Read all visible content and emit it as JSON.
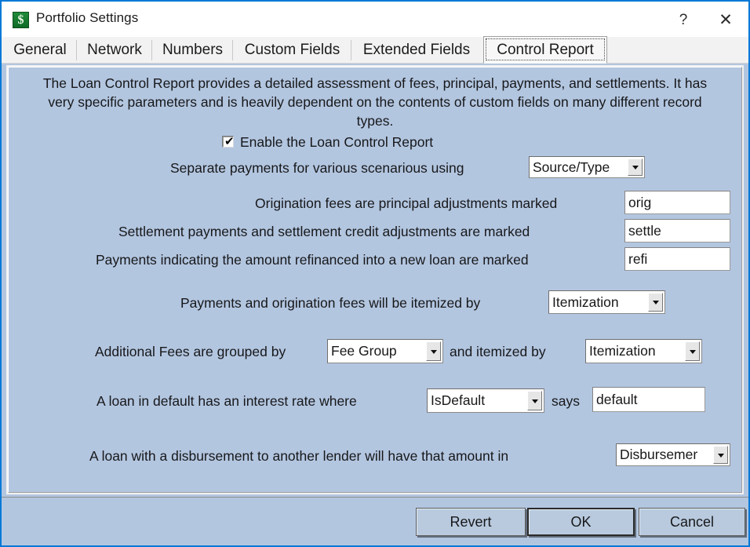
{
  "window": {
    "title": "Portfolio Settings",
    "app_icon": "dollar-sign-icon",
    "dollar_glyph": "$",
    "help_glyph": "?",
    "close_glyph": "✕"
  },
  "tabs": [
    {
      "label": "General",
      "active": false
    },
    {
      "label": "Network",
      "active": false
    },
    {
      "label": "Numbers",
      "active": false
    },
    {
      "label": "Custom Fields",
      "active": false
    },
    {
      "label": "Extended Fields",
      "active": false
    },
    {
      "label": "Control Report",
      "active": true
    }
  ],
  "panel": {
    "description": "The Loan Control Report provides a detailed assessment of fees, principal, payments, and settlements.  It has very specific parameters and is heavily dependent on the contents of custom fields on many different record types.",
    "enable_checkbox": {
      "label": "Enable the Loan Control Report",
      "checked": true,
      "check_glyph": "✔"
    },
    "separate_payments": {
      "label": "Separate payments for various scenarious using",
      "value": "Source/Type"
    },
    "origination_fees": {
      "label": "Origination fees are principal adjustments marked",
      "value": "orig"
    },
    "settlement_payments": {
      "label": "Settlement payments and settlement credit adjustments are marked",
      "value": "settle"
    },
    "refinance_payments": {
      "label": "Payments indicating the amount refinanced into a new loan are marked",
      "value": "refi"
    },
    "payments_itemized": {
      "label": "Payments and origination fees will be itemized by",
      "value": "Itemization"
    },
    "additional_fees": {
      "label_grouped": "Additional Fees are grouped by",
      "value_grouped": "Fee Group",
      "label_itemized": "and itemized by",
      "value_itemized": "Itemization"
    },
    "default_loan": {
      "label": "A loan in default has an interest rate where",
      "value_field": "IsDefault",
      "label_says": "says",
      "value_says": "default"
    },
    "disbursement": {
      "label": "A loan with a disbursement to another lender will have that amount in",
      "value": "Disbursemer"
    }
  },
  "footer": {
    "revert_label": "Revert",
    "ok_label": "OK",
    "cancel_label": "Cancel"
  },
  "colors": {
    "panel_bg": "#b3c6e0",
    "window_border": "#0078d7",
    "titlebar_bg": "#ffffff",
    "tabstrip_bg": "#f2f2f2",
    "text": "#17181a"
  }
}
